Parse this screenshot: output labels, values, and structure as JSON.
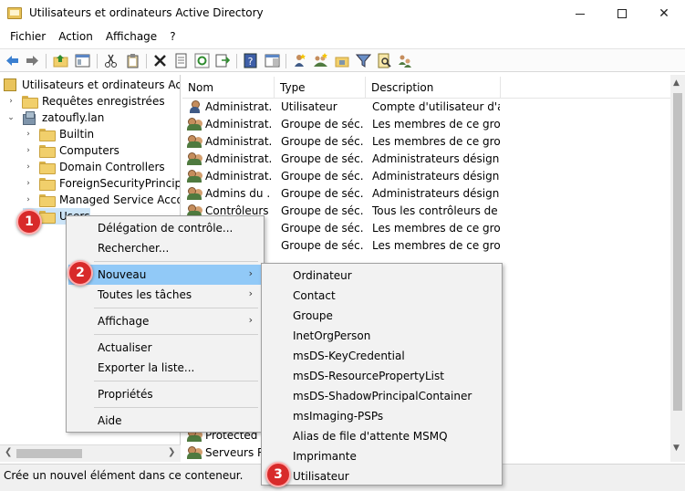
{
  "window": {
    "title": "Utilisateurs et ordinateurs Active Directory"
  },
  "menubar": [
    "Fichier",
    "Action",
    "Affichage",
    "?"
  ],
  "tree": {
    "root": "Utilisateurs et ordinateurs Active Directory",
    "saved_queries": "Requêtes enregistrées",
    "domain": "zatoufly.lan",
    "children": [
      "Builtin",
      "Computers",
      "Domain Controllers",
      "ForeignSecurityPrincipals",
      "Managed Service Accounts",
      "Users"
    ]
  },
  "list": {
    "columns": [
      "Nom",
      "Type",
      "Description"
    ],
    "rows": [
      {
        "icon": "user",
        "name": "Administrat...",
        "type": "Utilisateur",
        "description": "Compte d'utilisateur d'a..."
      },
      {
        "icon": "group",
        "name": "Administrat...",
        "type": "Groupe de séc...",
        "description": "Les membres de ce grou..."
      },
      {
        "icon": "group",
        "name": "Administrat...",
        "type": "Groupe de séc...",
        "description": "Les membres de ce grou..."
      },
      {
        "icon": "group",
        "name": "Administrat...",
        "type": "Groupe de séc...",
        "description": "Administrateurs désigné..."
      },
      {
        "icon": "group",
        "name": "Administrat...",
        "type": "Groupe de séc...",
        "description": "Administrateurs désigné..."
      },
      {
        "icon": "group",
        "name": "Admins du ...",
        "type": "Groupe de séc...",
        "description": "Administrateurs désigné..."
      },
      {
        "icon": "group",
        "name": "Contrôleurs ...",
        "type": "Groupe de séc...",
        "description": "Tous les contrôleurs de ..."
      },
      {
        "icon": "group",
        "name": "",
        "type": "Groupe de séc...",
        "description": "Les membres de ce grou..."
      },
      {
        "icon": "group",
        "name": "",
        "type": "Groupe de séc...",
        "description": "Les membres de ce grou..."
      }
    ],
    "bottom_rows": [
      {
        "icon": "group",
        "name": "Protected U"
      },
      {
        "icon": "group",
        "name": "Serveurs RA"
      }
    ]
  },
  "context_menu": {
    "items": [
      {
        "label": "Délégation de contrôle...",
        "submenu": false
      },
      {
        "label": "Rechercher...",
        "submenu": false
      },
      {
        "label": "Nouveau",
        "submenu": true,
        "highlighted": true
      },
      {
        "label": "Toutes les tâches",
        "submenu": true
      },
      {
        "label": "Affichage",
        "submenu": true
      },
      {
        "label": "Actualiser",
        "submenu": false
      },
      {
        "label": "Exporter la liste...",
        "submenu": false
      },
      {
        "label": "Propriétés",
        "submenu": false
      },
      {
        "label": "Aide",
        "submenu": false
      }
    ]
  },
  "submenu_nouveau": {
    "items": [
      "Ordinateur",
      "Contact",
      "Groupe",
      "InetOrgPerson",
      "msDS-KeyCredential",
      "msDS-ResourcePropertyList",
      "msDS-ShadowPrincipalContainer",
      "msImaging-PSPs",
      "Alias de file d'attente MSMQ",
      "Imprimante",
      "Utilisateur"
    ]
  },
  "badges": [
    "1",
    "2",
    "3"
  ],
  "statusbar": {
    "text": "Crée un nouvel élément dans ce conteneur."
  },
  "colors": {
    "highlight": "#91c9f7",
    "badge": "#d82a2a",
    "menu_bg": "#f2f2f2"
  }
}
